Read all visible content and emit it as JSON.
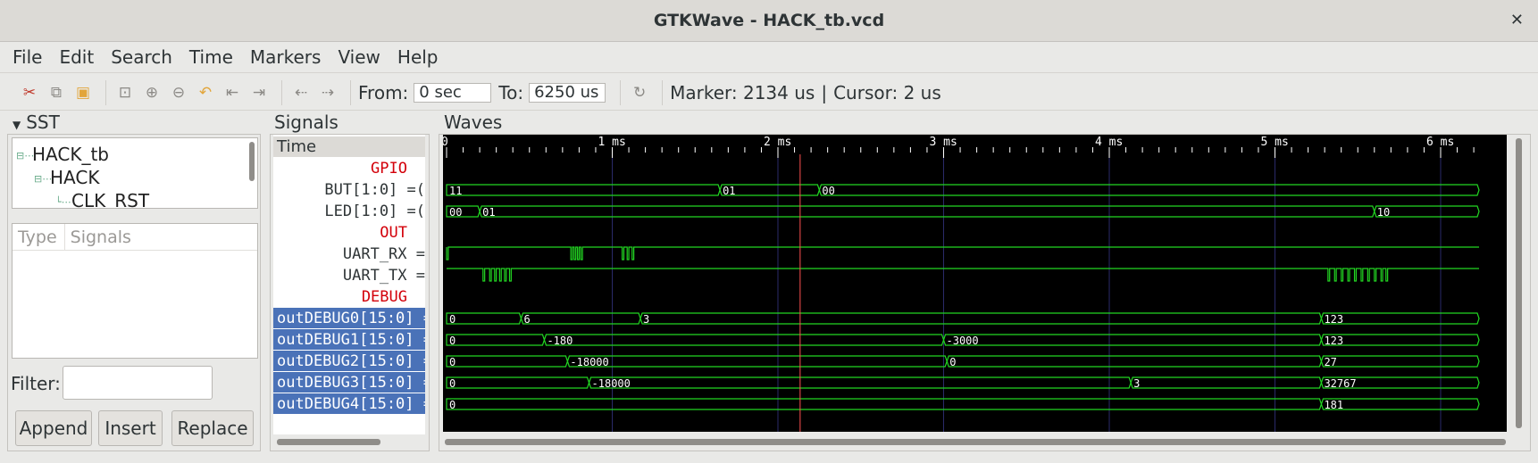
{
  "window": {
    "title": "GTKWave - HACK_tb.vcd",
    "close_glyph": "✕"
  },
  "menu": [
    "File",
    "Edit",
    "Search",
    "Time",
    "Markers",
    "View",
    "Help"
  ],
  "toolbar": {
    "from_label": "From:",
    "from_value": "0 sec",
    "to_label": "To:",
    "to_value": "6250 us",
    "marker": "Marker: 2134 us",
    "separator": "|",
    "cursor": "Cursor: 2 us"
  },
  "sst": {
    "header": "SST",
    "tree": [
      "HACK_tb",
      "HACK",
      "CLK_RST"
    ],
    "type_col": "Type",
    "signals_col": "Signals",
    "filter_label": "Filter:",
    "filter_value": "",
    "buttons": {
      "append": "Append",
      "insert": "Insert",
      "replace": "Replace"
    }
  },
  "signals_panel": {
    "header": "Signals",
    "rows": [
      {
        "label": "Time",
        "kind": "time"
      },
      {
        "label": "GPIO",
        "kind": "comment"
      },
      {
        "label": "BUT[1:0] =(",
        "kind": "signal"
      },
      {
        "label": "LED[1:0] =(",
        "kind": "signal"
      },
      {
        "label": "OUT",
        "kind": "comment"
      },
      {
        "label": "UART_RX =",
        "kind": "signal"
      },
      {
        "label": "UART_TX =",
        "kind": "signal"
      },
      {
        "label": "DEBUG",
        "kind": "comment"
      },
      {
        "label": "outDEBUG0[15:0] =",
        "kind": "selected"
      },
      {
        "label": "outDEBUG1[15:0] =",
        "kind": "selected"
      },
      {
        "label": "outDEBUG2[15:0] =",
        "kind": "selected"
      },
      {
        "label": "outDEBUG3[15:0] =",
        "kind": "selected"
      },
      {
        "label": "outDEBUG4[15:0] =(",
        "kind": "selected"
      }
    ]
  },
  "waves": {
    "header": "Waves",
    "time_unit": "ms",
    "view_range_ms": [
      0,
      6.25
    ],
    "tick_labels": [
      "0",
      "1 ms",
      "2 ms",
      "3 ms",
      "4 ms",
      "5 ms",
      "6 ms"
    ],
    "marker_ms": 2.134,
    "colors": {
      "wave": "#22d622",
      "marker": "#ff4f4f",
      "grid": "#2a2a6a",
      "background": "#000000"
    },
    "buses": [
      {
        "row": 2,
        "name": "BUT[1:0]",
        "segments": [
          {
            "t": 0,
            "v": "11"
          },
          {
            "t": 1.65,
            "v": "01"
          },
          {
            "t": 2.25,
            "v": "00"
          }
        ]
      },
      {
        "row": 3,
        "name": "LED[1:0]",
        "segments": [
          {
            "t": 0,
            "v": "00"
          },
          {
            "t": 0.2,
            "v": "01"
          },
          {
            "t": 5.6,
            "v": "10"
          }
        ]
      },
      {
        "row": 8,
        "name": "outDEBUG0[15:0]",
        "segments": [
          {
            "t": 0,
            "v": "0"
          },
          {
            "t": 0.45,
            "v": "6"
          },
          {
            "t": 1.17,
            "v": "3"
          },
          {
            "t": 5.28,
            "v": "123"
          }
        ]
      },
      {
        "row": 9,
        "name": "outDEBUG1[15:0]",
        "segments": [
          {
            "t": 0,
            "v": "0"
          },
          {
            "t": 0.59,
            "v": "-180"
          },
          {
            "t": 3.0,
            "v": "-3000"
          },
          {
            "t": 5.28,
            "v": "123"
          }
        ]
      },
      {
        "row": 10,
        "name": "outDEBUG2[15:0]",
        "segments": [
          {
            "t": 0,
            "v": "0"
          },
          {
            "t": 0.73,
            "v": "-18000"
          },
          {
            "t": 3.02,
            "v": "0"
          },
          {
            "t": 5.28,
            "v": "27"
          }
        ]
      },
      {
        "row": 11,
        "name": "outDEBUG3[15:0]",
        "segments": [
          {
            "t": 0,
            "v": "0"
          },
          {
            "t": 0.86,
            "v": "-18000"
          },
          {
            "t": 4.13,
            "v": "3"
          },
          {
            "t": 5.28,
            "v": "32767"
          }
        ]
      },
      {
        "row": 12,
        "name": "outDEBUG4[15:0]",
        "segments": [
          {
            "t": 0,
            "v": "0"
          },
          {
            "t": 5.28,
            "v": "181"
          }
        ]
      }
    ],
    "bits": [
      {
        "row": 5,
        "name": "UART_RX",
        "edges": [
          0.0,
          0.01,
          0.75,
          0.76,
          0.77,
          0.78,
          0.79,
          0.8,
          0.81,
          0.82,
          1.06,
          1.07,
          1.09,
          1.1,
          1.12,
          1.13
        ]
      },
      {
        "row": 6,
        "name": "UART_TX",
        "edges": [
          0.22,
          0.23,
          0.26,
          0.27,
          0.29,
          0.3,
          0.32,
          0.33,
          0.35,
          0.36,
          0.38,
          0.39,
          5.32,
          5.33,
          5.36,
          5.37,
          5.4,
          5.41,
          5.44,
          5.45,
          5.48,
          5.49,
          5.52,
          5.53,
          5.56,
          5.57,
          5.6,
          5.61,
          5.64,
          5.65,
          5.67,
          5.68
        ]
      }
    ]
  }
}
